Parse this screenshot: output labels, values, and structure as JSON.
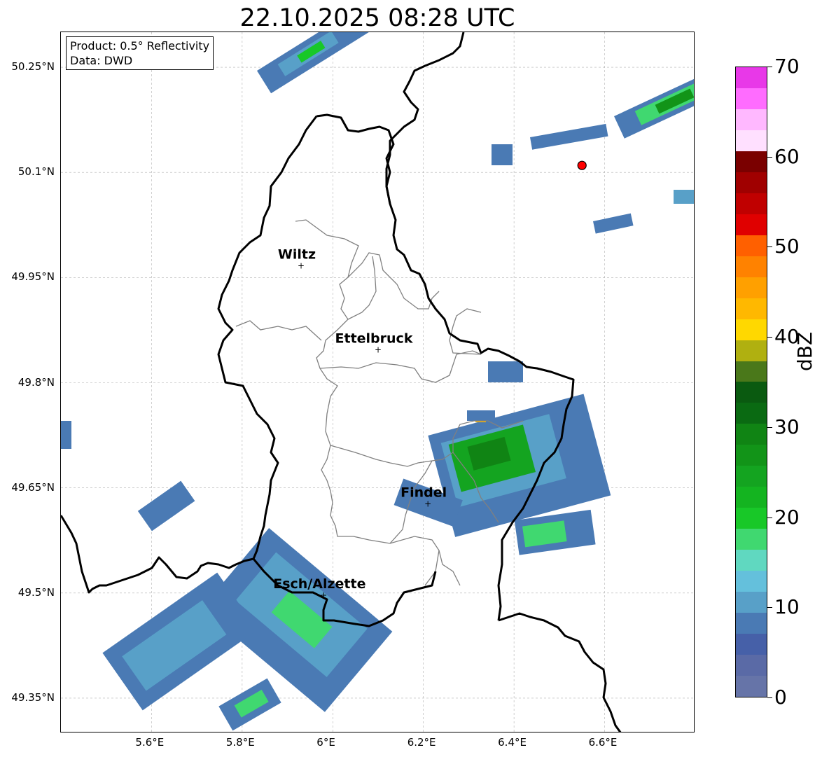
{
  "title": "22.10.2025 08:28 UTC",
  "info": {
    "product": "Product: 0.5° Reflectivity",
    "data": "Data: DWD"
  },
  "map": {
    "lon_range": [
      5.4,
      6.8
    ],
    "lat_range": [
      49.3,
      50.3
    ],
    "lon_ticks": [
      "5.6°E",
      "5.8°E",
      "6°E",
      "6.2°E",
      "6.4°E",
      "6.6°E"
    ],
    "lat_ticks": [
      "50.25°N",
      "50.1°N",
      "49.95°N",
      "49.8°N",
      "49.65°N",
      "49.5°N",
      "49.35°N"
    ],
    "cities": [
      {
        "name": "Wiltz",
        "lon": 5.93,
        "lat": 49.967
      },
      {
        "name": "Ettelbruck",
        "lon": 6.1,
        "lat": 49.847
      },
      {
        "name": "Findel",
        "lon": 6.21,
        "lat": 49.627
      },
      {
        "name": "Esch/Alzette",
        "lon": 5.98,
        "lat": 49.497
      }
    ],
    "radar_marker": {
      "lon": 6.55,
      "lat": 50.11,
      "color": "#ff0000"
    }
  },
  "colorbar": {
    "label": "dBZ",
    "ticks": [
      "0",
      "10",
      "20",
      "30",
      "40",
      "50",
      "60",
      "70"
    ],
    "colors": [
      "#6674a8",
      "#5a6aa6",
      "#4660a8",
      "#4a7ab4",
      "#58a0c8",
      "#64c0dc",
      "#60d8c0",
      "#40d870",
      "#18c828",
      "#14b420",
      "#14a420",
      "#129418",
      "#108414",
      "#0a6a12",
      "#0a5a10",
      "#4a781a",
      "#b0b010",
      "#ffd800",
      "#ffb800",
      "#ffa000",
      "#ff8200",
      "#ff6000",
      "#e00000",
      "#c00000",
      "#a00000",
      "#7a0000",
      "#ffe0ff",
      "#ffb8ff",
      "#ff6cff",
      "#e838e8"
    ]
  }
}
